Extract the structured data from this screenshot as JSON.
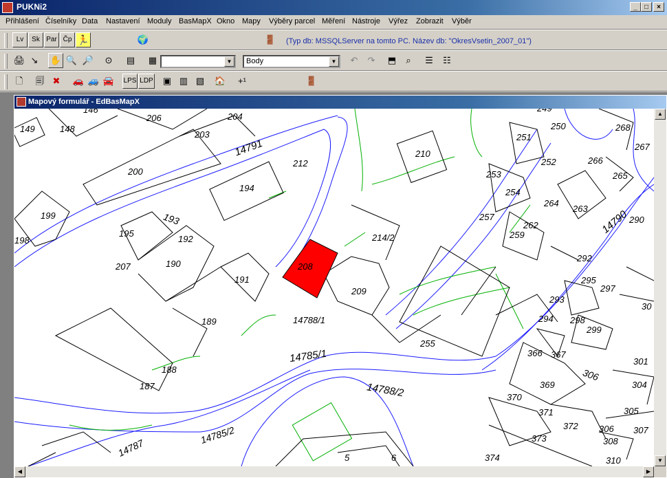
{
  "app": {
    "title": "PUKNi2"
  },
  "window_buttons": {
    "minimize": "_",
    "maximize": "□",
    "close": "×"
  },
  "menu": [
    "Přihlášení",
    "Číselníky",
    "Data",
    "Nastavení",
    "Moduly",
    "BasMapX",
    "Okno",
    "Mapy",
    "Výběry parcel",
    "Měření",
    "Nástroje",
    "Výřez",
    "Zobrazit",
    "Výběr"
  ],
  "toolbar1": {
    "buttons": [
      "Lv",
      "Sk",
      "Par",
      "Čp"
    ],
    "info_text": "(Typ db: MSSQLServer na tomto PC. Název db: \"OkresVsetin_2007_01\")"
  },
  "toolbar2": {
    "combo1_value": "",
    "combo2_value": "Body"
  },
  "toolbar3": {
    "buttons": [
      "LPS",
      "LDP"
    ],
    "plus_label": "+¹"
  },
  "child_window": {
    "title": "Mapový formulář - EdBasMapX"
  },
  "map": {
    "selected_parcel": "208",
    "selected_color": "#ff0000",
    "line_color": "#000000",
    "boundary_color": "#0000cc",
    "green_color": "#00aa00",
    "labels": [
      {
        "t": "149",
        "k": "l1"
      },
      {
        "t": "148",
        "k": "l2"
      },
      {
        "t": "146",
        "k": "l3"
      },
      {
        "t": "206",
        "k": "l4"
      },
      {
        "t": "204",
        "k": "l5"
      },
      {
        "t": "203",
        "k": "l6"
      },
      {
        "t": "14791",
        "k": "l7"
      },
      {
        "t": "212",
        "k": "l8"
      },
      {
        "t": "210",
        "k": "l9"
      },
      {
        "t": "200",
        "k": "l10"
      },
      {
        "t": "194",
        "k": "l11"
      },
      {
        "t": "199",
        "k": "l12"
      },
      {
        "t": "193",
        "k": "l13"
      },
      {
        "t": "195",
        "k": "l14"
      },
      {
        "t": "192",
        "k": "l15"
      },
      {
        "t": "198",
        "k": "l16"
      },
      {
        "t": "207",
        "k": "l17"
      },
      {
        "t": "190",
        "k": "l18"
      },
      {
        "t": "191",
        "k": "l19"
      },
      {
        "t": "214/2",
        "k": "l20"
      },
      {
        "t": "209",
        "k": "l21"
      },
      {
        "t": "189",
        "k": "l22"
      },
      {
        "t": "14788/1",
        "k": "l23"
      },
      {
        "t": "188",
        "k": "l24"
      },
      {
        "t": "14785/1",
        "k": "l25"
      },
      {
        "t": "187",
        "k": "l26"
      },
      {
        "t": "14788/2",
        "k": "l27"
      },
      {
        "t": "14785/2",
        "k": "l28"
      },
      {
        "t": "14787",
        "k": "l29"
      },
      {
        "t": "5",
        "k": "l30"
      },
      {
        "t": "6",
        "k": "l31"
      },
      {
        "t": "255",
        "k": "l32"
      },
      {
        "t": "251",
        "k": "l33"
      },
      {
        "t": "250",
        "k": "l34"
      },
      {
        "t": "249",
        "k": "l35"
      },
      {
        "t": "268",
        "k": "l36"
      },
      {
        "t": "267",
        "k": "l37"
      },
      {
        "t": "252",
        "k": "l38"
      },
      {
        "t": "266",
        "k": "l39"
      },
      {
        "t": "253",
        "k": "l40"
      },
      {
        "t": "254",
        "k": "l41"
      },
      {
        "t": "265",
        "k": "l42"
      },
      {
        "t": "264",
        "k": "l43"
      },
      {
        "t": "263",
        "k": "l44"
      },
      {
        "t": "14790",
        "k": "l45"
      },
      {
        "t": "257",
        "k": "l46"
      },
      {
        "t": "262",
        "k": "l47"
      },
      {
        "t": "259",
        "k": "l48"
      },
      {
        "t": "290",
        "k": "l49"
      },
      {
        "t": "292",
        "k": "l50"
      },
      {
        "t": "295",
        "k": "l51"
      },
      {
        "t": "297",
        "k": "l52"
      },
      {
        "t": "293",
        "k": "l53"
      },
      {
        "t": "294",
        "k": "l54"
      },
      {
        "t": "298",
        "k": "l55"
      },
      {
        "t": "299",
        "k": "l56"
      },
      {
        "t": "30",
        "k": "l57"
      },
      {
        "t": "366",
        "k": "l58"
      },
      {
        "t": "367",
        "k": "l59"
      },
      {
        "t": "306",
        "k": "l60"
      },
      {
        "t": "301",
        "k": "l61"
      },
      {
        "t": "304",
        "k": "l62"
      },
      {
        "t": "369",
        "k": "l63"
      },
      {
        "t": "370",
        "k": "l64"
      },
      {
        "t": "305",
        "k": "l65"
      },
      {
        "t": "371",
        "k": "l66"
      },
      {
        "t": "372",
        "k": "l67"
      },
      {
        "t": "306",
        "k": "l68"
      },
      {
        "t": "307",
        "k": "l69"
      },
      {
        "t": "373",
        "k": "l70"
      },
      {
        "t": "308",
        "k": "l71"
      },
      {
        "t": "374",
        "k": "l72"
      },
      {
        "t": "310",
        "k": "l73"
      }
    ]
  }
}
